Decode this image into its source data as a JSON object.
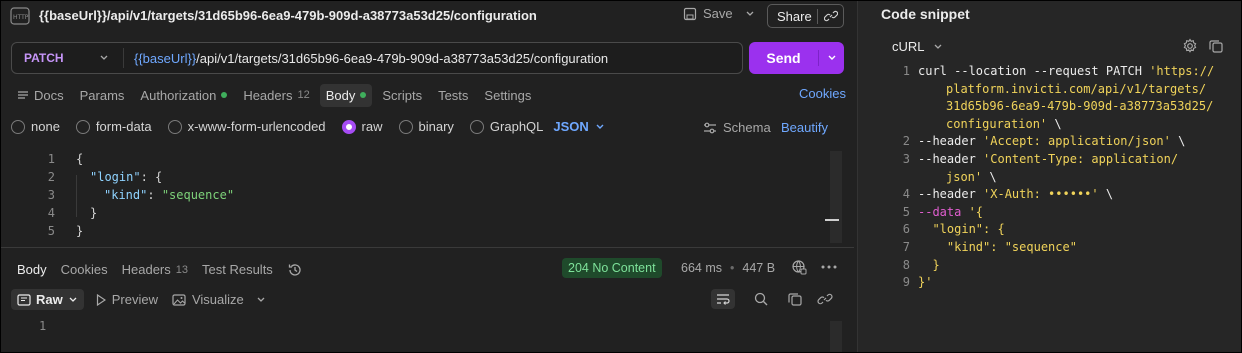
{
  "request": {
    "title": "{{baseUrl}}/api/v1/targets/31d65b96-6ea9-479b-909d-a38773a53d25/configuration",
    "save_label": "Save",
    "share_label": "Share",
    "method": "PATCH",
    "url_var": "{{baseUrl}}",
    "url_rest": "/api/v1/targets/31d65b96-6ea9-479b-909d-a38773a53d25/configuration",
    "send_label": "Send"
  },
  "tabs": [
    {
      "label": "Docs"
    },
    {
      "label": "Params"
    },
    {
      "label": "Authorization"
    },
    {
      "label": "Headers",
      "count": "12"
    },
    {
      "label": "Body"
    },
    {
      "label": "Scripts"
    },
    {
      "label": "Tests"
    },
    {
      "label": "Settings"
    }
  ],
  "cookies_label": "Cookies",
  "body_types": [
    "none",
    "form-data",
    "x-www-form-urlencoded",
    "raw",
    "binary",
    "GraphQL"
  ],
  "selected_body_type": "raw",
  "json_label": "JSON",
  "schema_label": "Schema",
  "beautify_label": "Beautify",
  "editor": {
    "line_numbers": [
      "1",
      "2",
      "3",
      "4",
      "5"
    ],
    "lines": {
      "l1": "{",
      "l2_key": "\"login\"",
      "l2_rest": ": {",
      "l3_key": "\"kind\"",
      "l3_colon": ": ",
      "l3_val": "\"sequence\"",
      "l4": "}",
      "l5": "}"
    }
  },
  "response": {
    "tabs": [
      {
        "label": "Body"
      },
      {
        "label": "Cookies"
      },
      {
        "label": "Headers",
        "count": "13"
      },
      {
        "label": "Test Results"
      }
    ],
    "status": "204 No Content",
    "time": "664 ms",
    "size": "447 B",
    "view_modes": {
      "raw": "Raw",
      "preview": "Preview",
      "visualize": "Visualize"
    },
    "line_number": "1"
  },
  "snippet": {
    "title": "Code snippet",
    "language": "cURL",
    "lines": {
      "n1": "1",
      "n2": "2",
      "n3": "3",
      "n4": "4",
      "n5": "5",
      "n6": "6",
      "n7": "7",
      "n8": "8",
      "n9": "9",
      "l1a": "curl --location --request PATCH ",
      "l1b": "'https://",
      "l1c": "platform.invicti.com/api/v1/targets/",
      "l1d": "31d65b96-6ea9-479b-909d-a38773a53d25/",
      "l1e": "configuration'",
      "l1f": " \\",
      "l2a": "--header ",
      "l2b": "'Accept: application/json'",
      "l2c": " \\",
      "l3a": "--header ",
      "l3b": "'Content-Type: application/",
      "l3c": "json'",
      "l3d": " \\",
      "l4a": "--header ",
      "l4b": "'X-Auth: ••••••'",
      "l4c": " \\",
      "l5a": "--data ",
      "l5b": "'{",
      "l6": "  \"login\": {",
      "l7": "    \"kind\": \"sequence\"",
      "l8": "  }",
      "l9": "}'"
    }
  },
  "colors": {
    "accent": "#9b31ee",
    "link": "#6fa8ff",
    "status_ok": "#7ee29a"
  }
}
